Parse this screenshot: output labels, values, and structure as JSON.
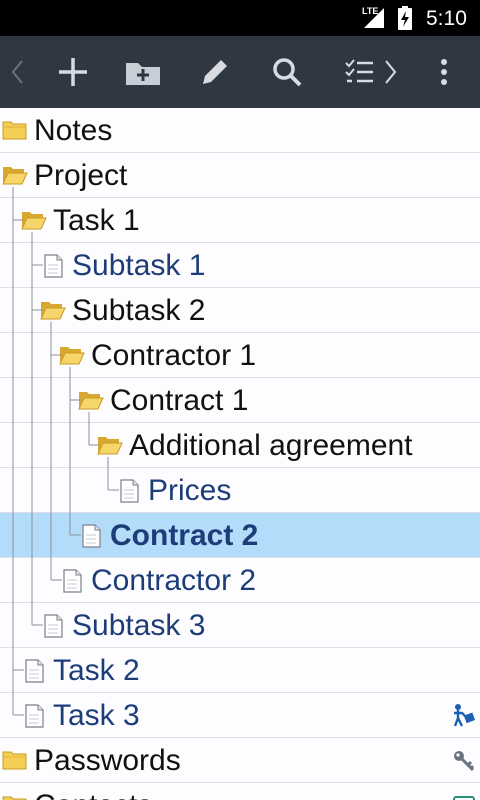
{
  "status_bar": {
    "network": "LTE",
    "time": "5:10"
  },
  "toolbar": {
    "buttons": [
      "back-icon",
      "add-icon",
      "add-folder-icon",
      "edit-icon",
      "search-icon",
      "checklist-icon",
      "forward-icon",
      "more-icon"
    ]
  },
  "tree": {
    "rows": [
      {
        "label": "Notes",
        "type": "folder",
        "open": false,
        "depth": 0
      },
      {
        "label": "Project",
        "type": "folder",
        "open": true,
        "depth": 0
      },
      {
        "label": "Task 1",
        "type": "folder",
        "open": true,
        "depth": 1
      },
      {
        "label": "Subtask 1",
        "type": "note",
        "depth": 2
      },
      {
        "label": "Subtask 2",
        "type": "folder",
        "open": true,
        "depth": 2
      },
      {
        "label": "Contractor 1",
        "type": "folder",
        "open": true,
        "depth": 3
      },
      {
        "label": "Contract 1",
        "type": "folder",
        "open": true,
        "depth": 4
      },
      {
        "label": "Additional agreement",
        "type": "folder",
        "open": true,
        "depth": 5
      },
      {
        "label": "Prices",
        "type": "note",
        "depth": 6
      },
      {
        "label": "Contract 2",
        "type": "note",
        "depth": 4,
        "selected": true
      },
      {
        "label": "Contractor 2",
        "type": "note",
        "depth": 3
      },
      {
        "label": "Subtask 3",
        "type": "note",
        "depth": 2
      },
      {
        "label": "Task 2",
        "type": "note",
        "depth": 1
      },
      {
        "label": "Task 3",
        "type": "note",
        "depth": 1,
        "badge": "task-delegate-icon"
      },
      {
        "label": "Passwords",
        "type": "folder",
        "open": false,
        "depth": 0,
        "badge": "key-icon"
      },
      {
        "label": "Contacts",
        "type": "folder",
        "open": false,
        "depth": 0,
        "badge": "contacts-card-icon"
      }
    ]
  },
  "colors": {
    "toolbar_bg": "#2f3742",
    "selected_row_bg": "#b3dcfb",
    "note_text": "#1c3d78",
    "folder_text": "#111111",
    "folder_icon": "#f2c94c"
  }
}
